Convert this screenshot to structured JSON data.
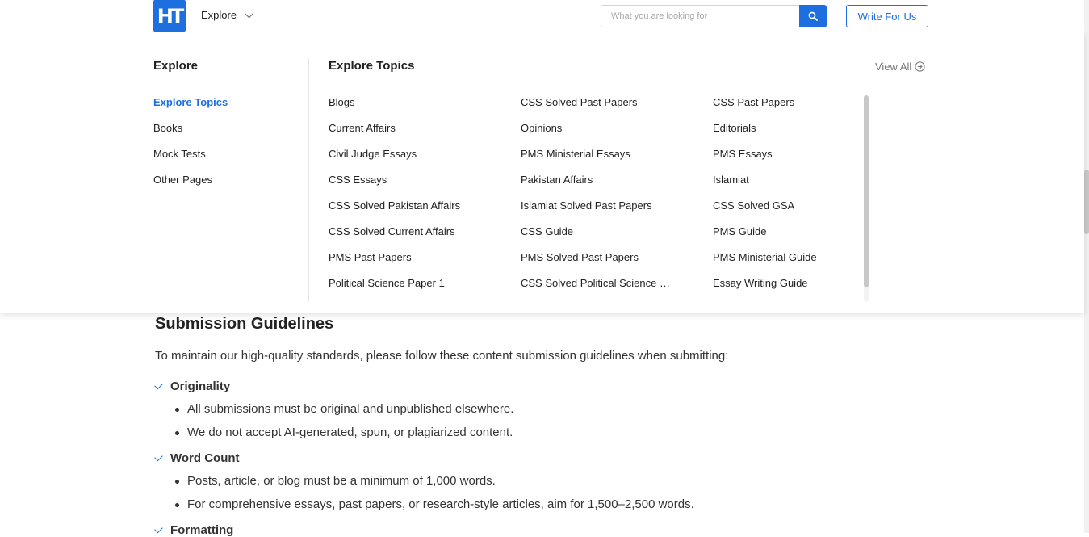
{
  "brand": {
    "logo_text": "HT",
    "color": "#1d6fe0"
  },
  "header": {
    "explore_label": "Explore",
    "search_placeholder": "What you are looking for",
    "write_label": "Write For Us"
  },
  "menu": {
    "left_title": "Explore",
    "left_items": [
      {
        "label": "Explore Topics",
        "active": true
      },
      {
        "label": "Books",
        "active": false
      },
      {
        "label": "Mock Tests",
        "active": false
      },
      {
        "label": "Other Pages",
        "active": false
      }
    ],
    "title": "Explore Topics",
    "view_all": "View All",
    "topics": [
      "Blogs",
      "CSS Solved Past Papers",
      "CSS Past Papers",
      "Current Affairs",
      "Opinions",
      "Editorials",
      "Civil Judge Essays",
      "PMS Ministerial Essays",
      "PMS Essays",
      "CSS Essays",
      "Pakistan Affairs",
      "Islamiat",
      "CSS Solved Pakistan Affairs",
      "Islamiat Solved Past Papers",
      "CSS Solved GSA",
      "CSS Solved Current Affairs",
      "CSS Guide",
      "PMS Guide",
      "PMS Past Papers",
      "PMS Solved Past Papers",
      "PMS Ministerial Guide",
      "Political Science Paper 1",
      "CSS Solved Political Science Past Papers",
      "Essay Writing Guide"
    ]
  },
  "content": {
    "title": "Submission Guidelines",
    "intro": "To maintain our high-quality standards, please follow these content submission guidelines when submitting:",
    "sections": [
      {
        "heading": "Originality",
        "bullets": [
          "All submissions must be original and unpublished elsewhere.",
          "We do not accept AI-generated, spun, or plagiarized content."
        ]
      },
      {
        "heading": "Word Count",
        "bullets": [
          "Posts, article, or blog must be a minimum of 1,000 words.",
          "For comprehensive essays, past papers, or research-style articles, aim for 1,500–2,500 words."
        ]
      },
      {
        "heading": "Formatting",
        "bullets": []
      }
    ]
  }
}
